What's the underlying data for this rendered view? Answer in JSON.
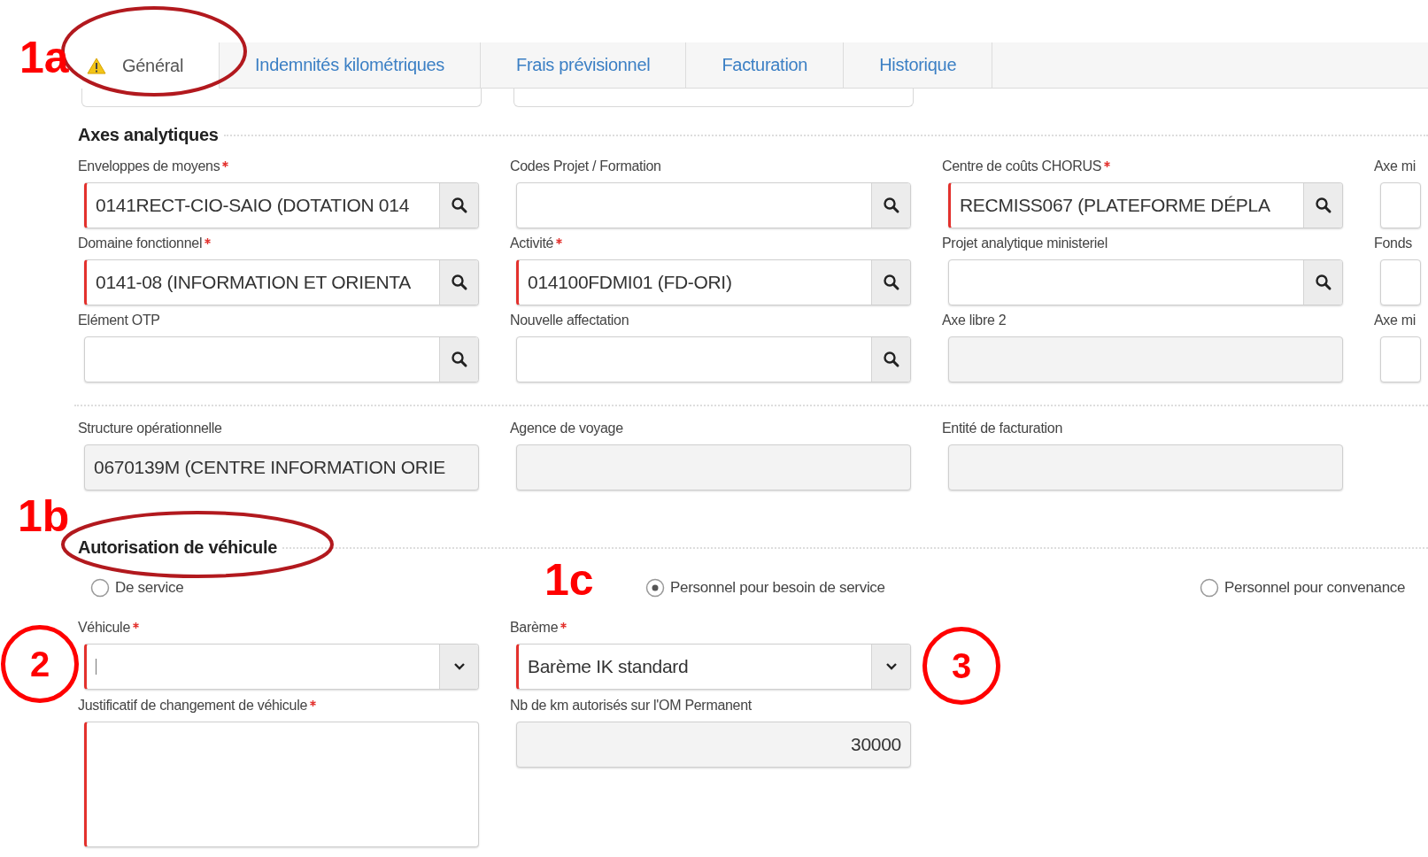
{
  "tabs": [
    {
      "label": "Général",
      "selected": true,
      "warning": true
    },
    {
      "label": "Indemnités kilométriques",
      "selected": false,
      "warning": false
    },
    {
      "label": "Frais prévisionnel",
      "selected": false,
      "warning": false
    },
    {
      "label": "Facturation",
      "selected": false,
      "warning": false
    },
    {
      "label": "Historique",
      "selected": false,
      "warning": false
    }
  ],
  "axes_section": {
    "title": "Axes analytiques",
    "fields": [
      {
        "label": "Enveloppes de moyens",
        "required": true,
        "kind": "lookup",
        "value": "0141RECT-CIO-SAIO (DOTATION 014"
      },
      {
        "label": "Codes Projet / Formation",
        "required": false,
        "kind": "lookup"
      },
      {
        "label": "Centre de coûts CHORUS",
        "required": true,
        "kind": "lookup",
        "value": "RECMISS067 (PLATEFORME DÉPLA"
      },
      {
        "label": "Axe mi",
        "required": false,
        "kind": "text"
      },
      {
        "label": "Domaine fonctionnel",
        "required": true,
        "kind": "lookup",
        "value": "0141-08 (INFORMATION ET ORIENTA"
      },
      {
        "label": "Activité",
        "required": true,
        "kind": "lookup",
        "value": "014100FDMI01 (FD-ORI)"
      },
      {
        "label": "Projet analytique ministeriel",
        "required": false,
        "kind": "lookup"
      },
      {
        "label": "Fonds",
        "required": false,
        "kind": "text"
      },
      {
        "label": "Elément OTP",
        "required": false,
        "kind": "lookup"
      },
      {
        "label": "Nouvelle affectation",
        "required": false,
        "kind": "lookup"
      },
      {
        "label": "Axe libre 2",
        "required": false,
        "kind": "readonly"
      },
      {
        "label": "Axe mi",
        "required": false,
        "kind": "text"
      }
    ]
  },
  "structure_fields": [
    {
      "label": "Structure opérationnelle",
      "required": false,
      "kind": "readonly",
      "value": "0670139M (CENTRE INFORMATION ORIE"
    },
    {
      "label": "Agence de voyage",
      "required": false,
      "kind": "readonly"
    },
    {
      "label": "Entité de facturation",
      "required": false,
      "kind": "readonly"
    }
  ],
  "vehicle_section": {
    "title": "Autorisation de véhicule",
    "options": [
      {
        "label": "De service",
        "selected": false
      },
      {
        "label": "Personnel pour besoin de service",
        "selected": true
      },
      {
        "label": "Personnel pour convenance",
        "selected": false
      }
    ],
    "columns": [
      [
        {
          "label": "Véhicule",
          "required": true,
          "kind": "select",
          "focused": true
        },
        {
          "label": "Justificatif de changement de véhicule",
          "required": true,
          "kind": "textarea"
        }
      ],
      [
        {
          "label": "Barème",
          "required": true,
          "kind": "select",
          "value": "Barème IK standard"
        },
        {
          "label": "Nb de km autorisés sur l'OM Permanent",
          "required": false,
          "kind": "number",
          "value": "30000"
        }
      ]
    ]
  },
  "annotations": [
    {
      "label": "1a",
      "kind": "ellipse"
    },
    {
      "label": "1b",
      "kind": "ellipse"
    },
    {
      "label": "1c",
      "kind": "plain"
    },
    {
      "label": "2",
      "kind": "circle"
    },
    {
      "label": "3",
      "kind": "circle"
    }
  ]
}
